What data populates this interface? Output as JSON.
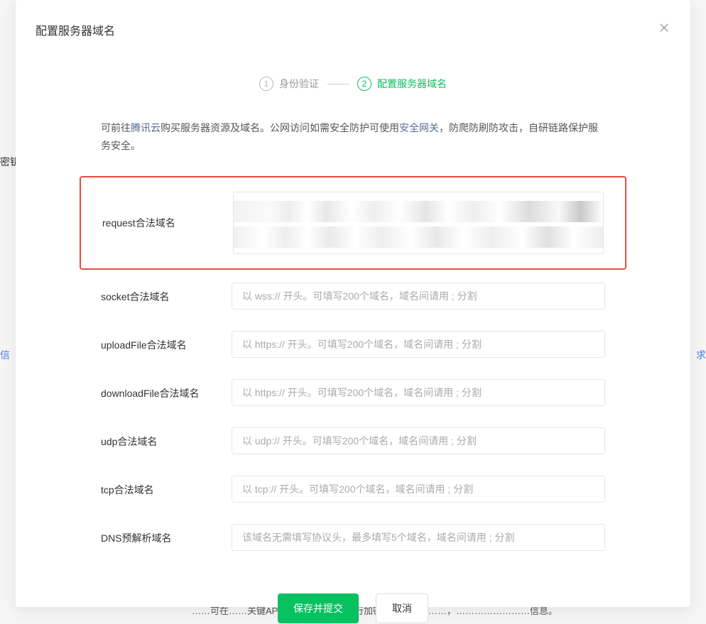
{
  "background": {
    "left1": "密钥",
    "left2": "信",
    "right": "求",
    "bottom": "……可在……关键API……对……信息进行加密，……网络……，……………………信息。"
  },
  "modal": {
    "title": "配置服务器域名"
  },
  "steps": {
    "step1": {
      "num": "1",
      "label": "身份验证"
    },
    "step2": {
      "num": "2",
      "label": "配置服务器域名"
    }
  },
  "description": {
    "prefix": "可前往",
    "link1": "腾讯云",
    "mid": "购买服务器资源及域名。公网访问如需安全防护可使用",
    "link2": "安全网关",
    "suffix": "，防爬防刷防攻击，自研链路保护服务安全。"
  },
  "fields": {
    "request": {
      "label": "request合法域名"
    },
    "socket": {
      "label": "socket合法域名",
      "placeholder": "以 wss:// 开头。可填写200个域名，域名间请用 ; 分割"
    },
    "uploadFile": {
      "label": "uploadFile合法域名",
      "placeholder": "以 https:// 开头。可填写200个域名，域名间请用 ; 分割"
    },
    "downloadFile": {
      "label": "downloadFile合法域名",
      "placeholder": "以 https:// 开头。可填写200个域名，域名间请用 ; 分割"
    },
    "udp": {
      "label": "udp合法域名",
      "placeholder": "以 udp:// 开头。可填写200个域名，域名间请用 ; 分割"
    },
    "tcp": {
      "label": "tcp合法域名",
      "placeholder": "以 tcp:// 开头。可填写200个域名，域名间请用 ; 分割"
    },
    "dns": {
      "label": "DNS预解析域名",
      "placeholder": "该域名无需填写协议头，最多填写5个域名，域名间请用 ; 分割"
    }
  },
  "actions": {
    "submit": "保存并提交",
    "cancel": "取消"
  }
}
